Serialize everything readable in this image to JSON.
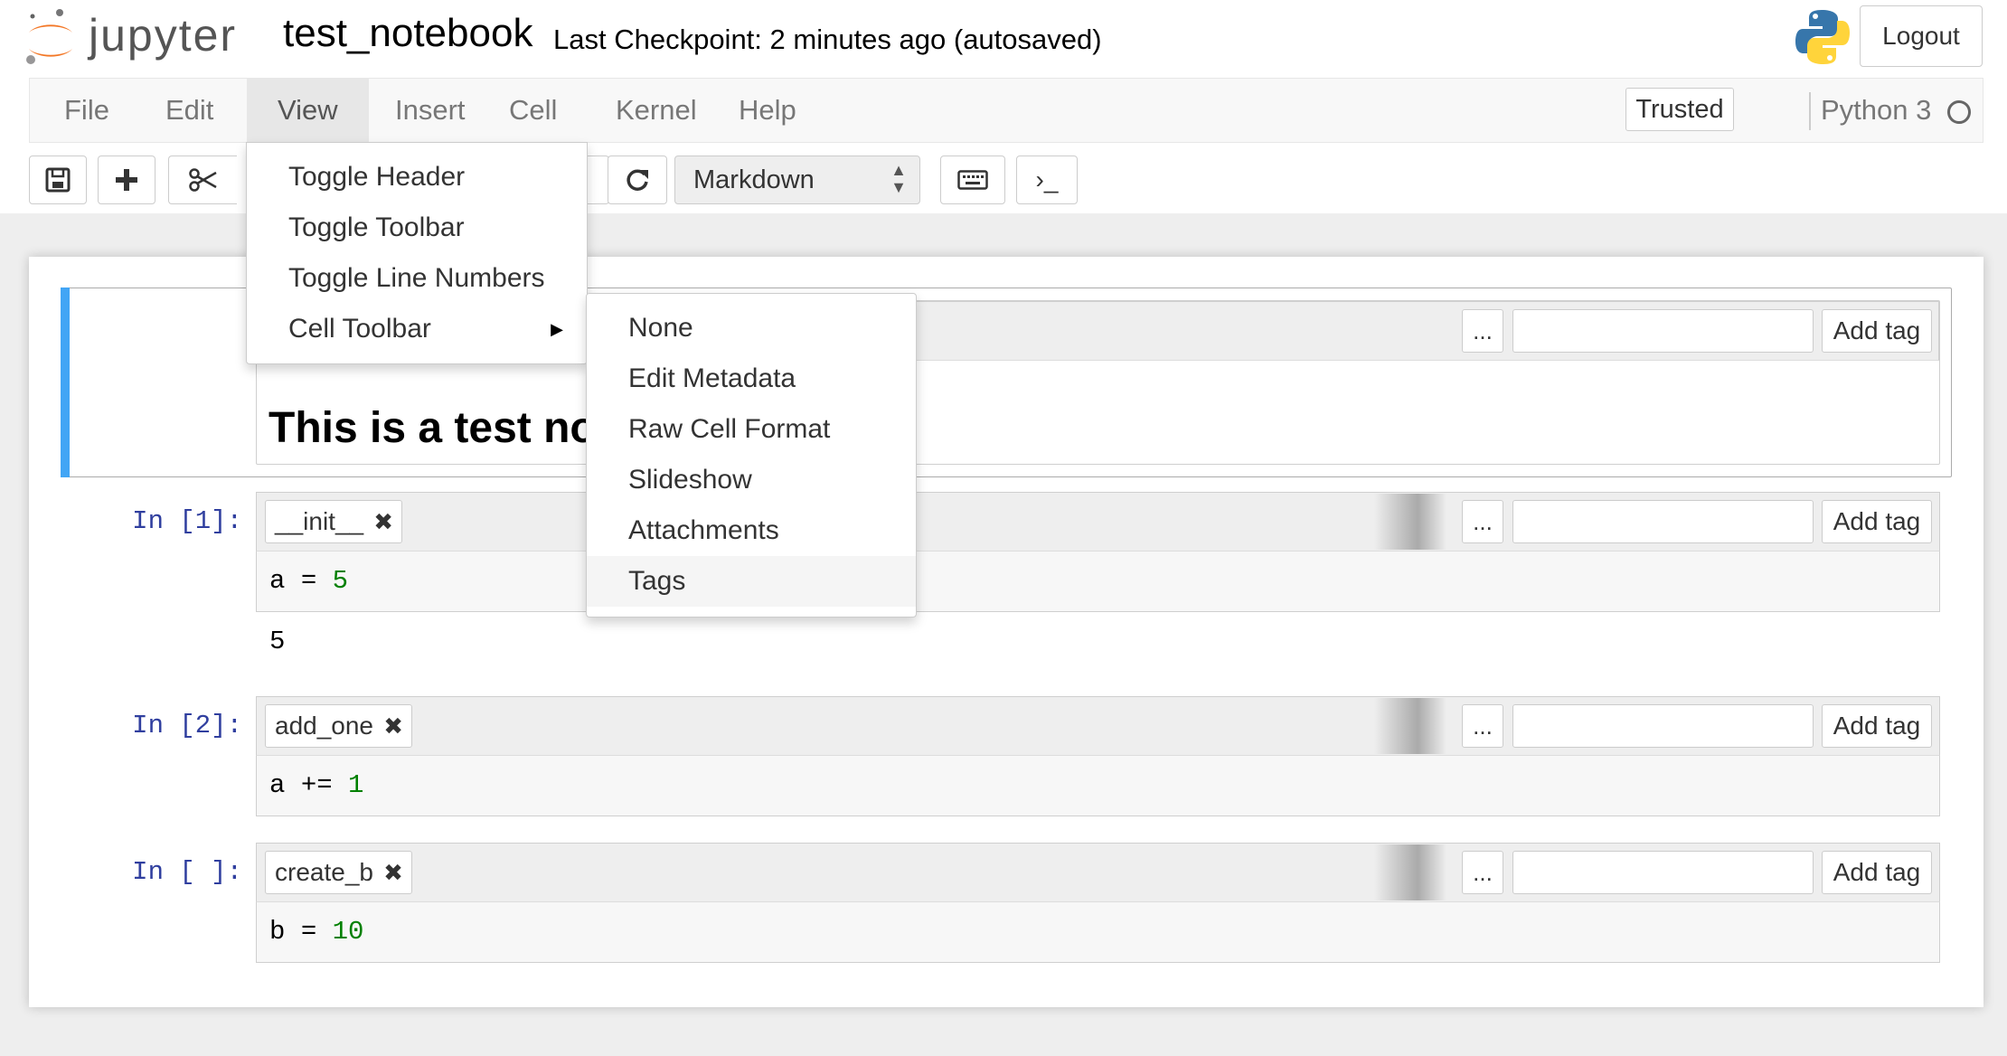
{
  "header": {
    "logo_text": "jupyter",
    "notebook_name": "test_notebook",
    "checkpoint": "Last Checkpoint: 2 minutes ago (autosaved)",
    "logout_label": "Logout"
  },
  "menubar": {
    "items": [
      "File",
      "Edit",
      "View",
      "Insert",
      "Cell",
      "Kernel",
      "Help"
    ],
    "active": "View",
    "trusted_label": "Trusted",
    "kernel_name": "Python 3"
  },
  "toolbar": {
    "cell_type": "Markdown",
    "terminal_label": "›_",
    "icons": [
      "save-icon",
      "plus-icon",
      "scissors-icon",
      "run-icon",
      "restart-icon",
      "keyboard-icon",
      "terminal-icon"
    ]
  },
  "view_menu": {
    "items": [
      "Toggle Header",
      "Toggle Toolbar",
      "Toggle Line Numbers",
      "Cell Toolbar"
    ]
  },
  "cell_toolbar_menu": {
    "items": [
      "None",
      "Edit Metadata",
      "Raw Cell Format",
      "Slideshow",
      "Attachments",
      "Tags"
    ],
    "highlighted": "Tags"
  },
  "cell_toolbar": {
    "dots_label": "...",
    "add_tag_label": "Add tag"
  },
  "cells": [
    {
      "type": "markdown",
      "heading": "This is a test notebook"
    },
    {
      "type": "code",
      "prompt": "In [1]:",
      "tag": "__init__",
      "code": [
        "a",
        "=",
        "5"
      ],
      "output": "5"
    },
    {
      "type": "code",
      "prompt": "In [2]:",
      "tag": "add_one",
      "code": [
        "a",
        "+=",
        "1"
      ]
    },
    {
      "type": "code",
      "prompt": "In [ ]:",
      "tag": "create_b",
      "code": [
        "b",
        "=",
        "10"
      ]
    }
  ],
  "colors": {
    "selected_bar": "#42a5f5",
    "prompt": "#303f9f",
    "number": "#008000",
    "logo_orange": "#f37726"
  }
}
